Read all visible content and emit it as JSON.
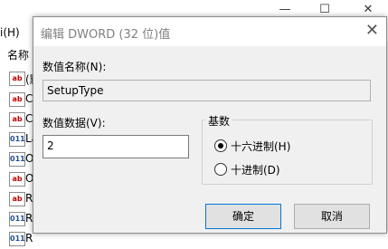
{
  "window": {
    "minimize_glyph": "—",
    "maximize_glyph": "☐",
    "close_glyph": "✕",
    "menu_fragment": "i(H)",
    "column_header_fragment": "名称",
    "rows": [
      {
        "icon": "ab",
        "text": "(默"
      },
      {
        "icon": "ab",
        "text": "C"
      },
      {
        "icon": "ab",
        "text": "C"
      },
      {
        "icon": "011",
        "text": "La"
      },
      {
        "icon": "011",
        "text": "O"
      },
      {
        "icon": "ab",
        "text": "O"
      },
      {
        "icon": "ab",
        "text": "R"
      },
      {
        "icon": "011",
        "text": "R"
      },
      {
        "icon": "011",
        "text": "R"
      }
    ]
  },
  "dialog": {
    "title": "编辑 DWORD (32 位)值",
    "close_glyph": "✕",
    "name_label": "数值名称(N):",
    "name_value": "SetupType",
    "data_label": "数值数据(V):",
    "data_value": "2",
    "base_legend": "基数",
    "base_options": [
      {
        "label": "十六进制(H)",
        "selected": true
      },
      {
        "label": "十进制(D)",
        "selected": false
      }
    ],
    "ok_label": "确定",
    "cancel_label": "取消"
  },
  "colors": {
    "dialog_bg": "#f0f0f0",
    "accent": "#0078d7"
  }
}
